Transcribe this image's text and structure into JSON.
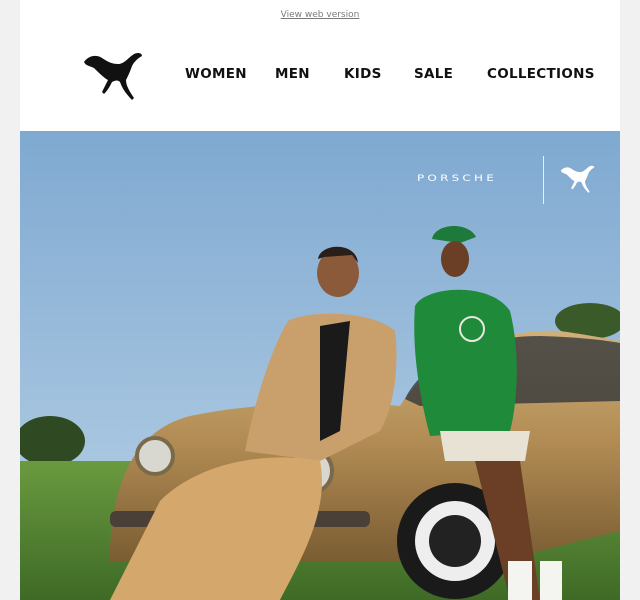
{
  "header": {
    "webview_link": "View web version",
    "nav": [
      "WOMEN",
      "MEN",
      "KIDS",
      "SALE",
      "COLLECTIONS"
    ]
  },
  "hero": {
    "partner_logo_text": "PORSCHE"
  },
  "icons": {
    "brand_logo": "puma-logo-icon",
    "partner_small_logo": "puma-logo-icon"
  },
  "colors": {
    "page_bg": "#f1f1f1",
    "email_bg": "#ffffff",
    "nav_text": "#111111",
    "sky": "#8cb4d8",
    "grass": "#4f7d34",
    "car_gold": "#b8965e",
    "sweater_green": "#1f8a3a"
  }
}
